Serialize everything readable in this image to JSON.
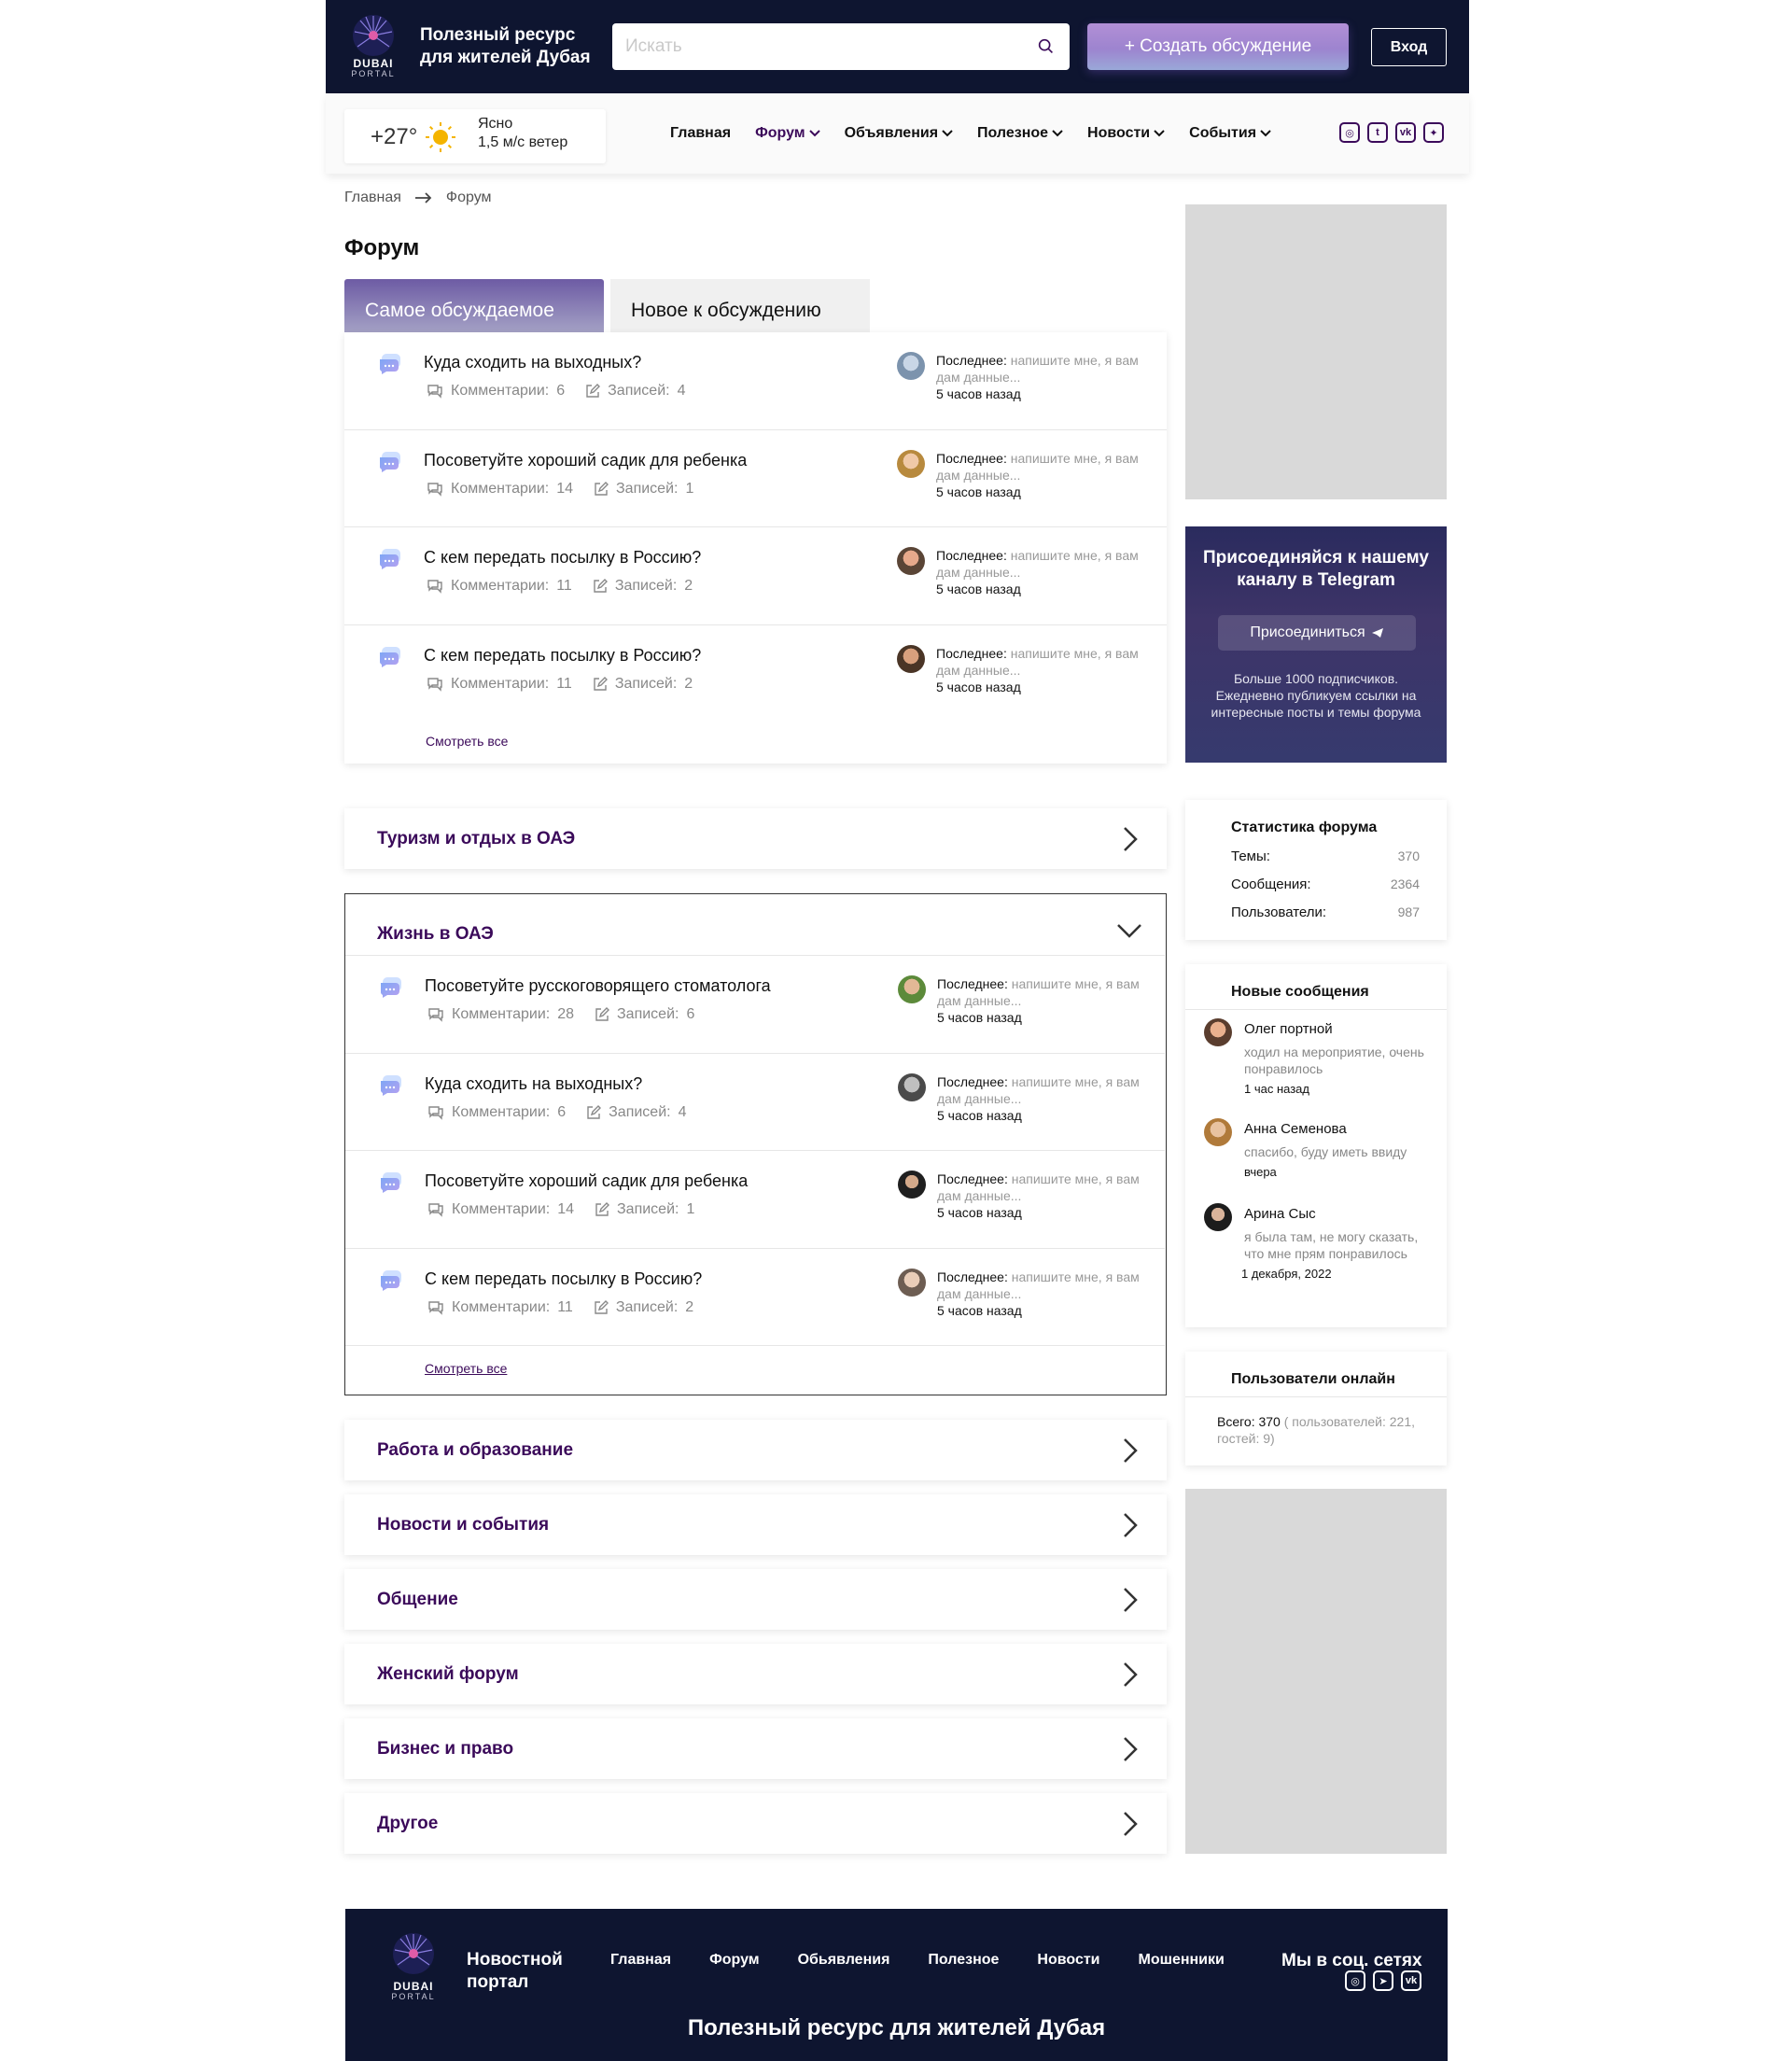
{
  "header": {
    "logo": {
      "line1": "DUBAI",
      "line2": "PORTAL"
    },
    "tagline": "Полезный ресурс для жителей Дубая",
    "search_placeholder": "Искать",
    "create_label": "+ Создать обсуждение",
    "login_label": "Вход"
  },
  "weather": {
    "temp": "+27°",
    "condition": "Ясно",
    "wind": "1,5 м/с ветер"
  },
  "nav": {
    "items": [
      {
        "label": "Главная",
        "dropdown": false
      },
      {
        "label": "Форум",
        "dropdown": true,
        "active": true
      },
      {
        "label": "Объявления",
        "dropdown": true
      },
      {
        "label": "Полезное",
        "dropdown": true
      },
      {
        "label": "Новости",
        "dropdown": true
      },
      {
        "label": "События",
        "dropdown": true
      }
    ],
    "socials": [
      "instagram-icon",
      "tumblr-icon",
      "vk-icon",
      "twitter-icon"
    ]
  },
  "breadcrumb": {
    "home": "Главная",
    "current": "Форум"
  },
  "page_title": "Форум",
  "tabs": {
    "active": "Самое обсуждаемое",
    "inactive": "Новое к обсуждению"
  },
  "labels": {
    "comments": "Комментарии:",
    "posts": "Записей:",
    "last": "Последнее:",
    "see_all": "Смотреть все"
  },
  "popular_topics": [
    {
      "title": "Куда сходить на выходных?",
      "comments": "6",
      "posts": "4",
      "last_text": "напишите мне, я вам дам данные...",
      "time": "5 часов назад"
    },
    {
      "title": "Посоветуйте хороший садик для ребенка",
      "comments": "14",
      "posts": "1",
      "last_text": "напишите мне, я вам дам данные...",
      "time": "5 часов назад"
    },
    {
      "title": "С кем передать посылку в Россию?",
      "comments": "11",
      "posts": "2",
      "last_text": "напишите мне, я вам дам данные...",
      "time": "5 часов назад"
    },
    {
      "title": "С кем передать посылку в Россию?",
      "comments": "11",
      "posts": "2",
      "last_text": "напишите мне, я вам дам данные...",
      "time": "5 часов назад"
    }
  ],
  "sections": {
    "tourism": "Туризм и отдых в ОАЭ",
    "life": "Жизнь в ОАЭ",
    "work": "Работа и образование",
    "news": "Новости и события",
    "talk": "Общение",
    "women": "Женский форум",
    "business": "Бизнес и право",
    "other": "Другое"
  },
  "life_topics": [
    {
      "title": "Посоветуйте русскоговорящего стоматолога",
      "comments": "28",
      "posts": "6",
      "last_text": "напишите мне, я вам дам данные...",
      "time": "5 часов назад"
    },
    {
      "title": "Куда сходить на выходных?",
      "comments": "6",
      "posts": "4",
      "last_text": "напишите мне, я вам дам данные...",
      "time": "5 часов назад"
    },
    {
      "title": "Посоветуйте хороший садик для ребенка",
      "comments": "14",
      "posts": "1",
      "last_text": "напишите мне, я вам дам данные...",
      "time": "5 часов назад"
    },
    {
      "title": "С кем передать посылку в Россию?",
      "comments": "11",
      "posts": "2",
      "last_text": "напишите мне, я вам дам данные...",
      "time": "5 часов назад"
    }
  ],
  "telegram": {
    "title": "Присоединяйся к нашему каналу в Telegram",
    "button": "Присоединиться",
    "desc": "Больше 1000 подписчиков. Ежедневно публикуем ссылки на интересные посты и темы форума"
  },
  "stats": {
    "title": "Статистика форума",
    "rows": [
      {
        "label": "Темы:",
        "value": "370"
      },
      {
        "label": "Сообщения:",
        "value": "2364"
      },
      {
        "label": "Пользователи:",
        "value": "987"
      }
    ]
  },
  "new_messages": {
    "title": "Новые сообщения",
    "items": [
      {
        "name": "Олег портной",
        "text": "ходил на мероприятие, очень понравилось",
        "date": "1 час назад"
      },
      {
        "name": "Анна Семенова",
        "text": "спасибо, буду иметь ввиду",
        "date": "вчера"
      },
      {
        "name": "Арина Сыс",
        "text": "я была там, не могу сказать, что мне прям понравилось",
        "date": "1 декабря, 2022"
      }
    ]
  },
  "online": {
    "title": "Пользователи онлайн",
    "total_label": "Всего: 370",
    "detail": "( пользователей: 221, гостей: 9)"
  },
  "footer": {
    "name": "Новостной портал",
    "nav": [
      "Главная",
      "Форум",
      "Обьявления",
      "Полезное",
      "Новости",
      "Мошенники"
    ],
    "social_title": "Мы в соц. сетях",
    "socials": [
      "instagram-icon",
      "telegram-icon",
      "vk-icon"
    ],
    "bottom": "Полезный ресурс для жителей Дубая"
  },
  "colors": {
    "dark": "#0e1530",
    "accent": "#3b0a5a",
    "ad_gray": "#d9d9d9"
  }
}
